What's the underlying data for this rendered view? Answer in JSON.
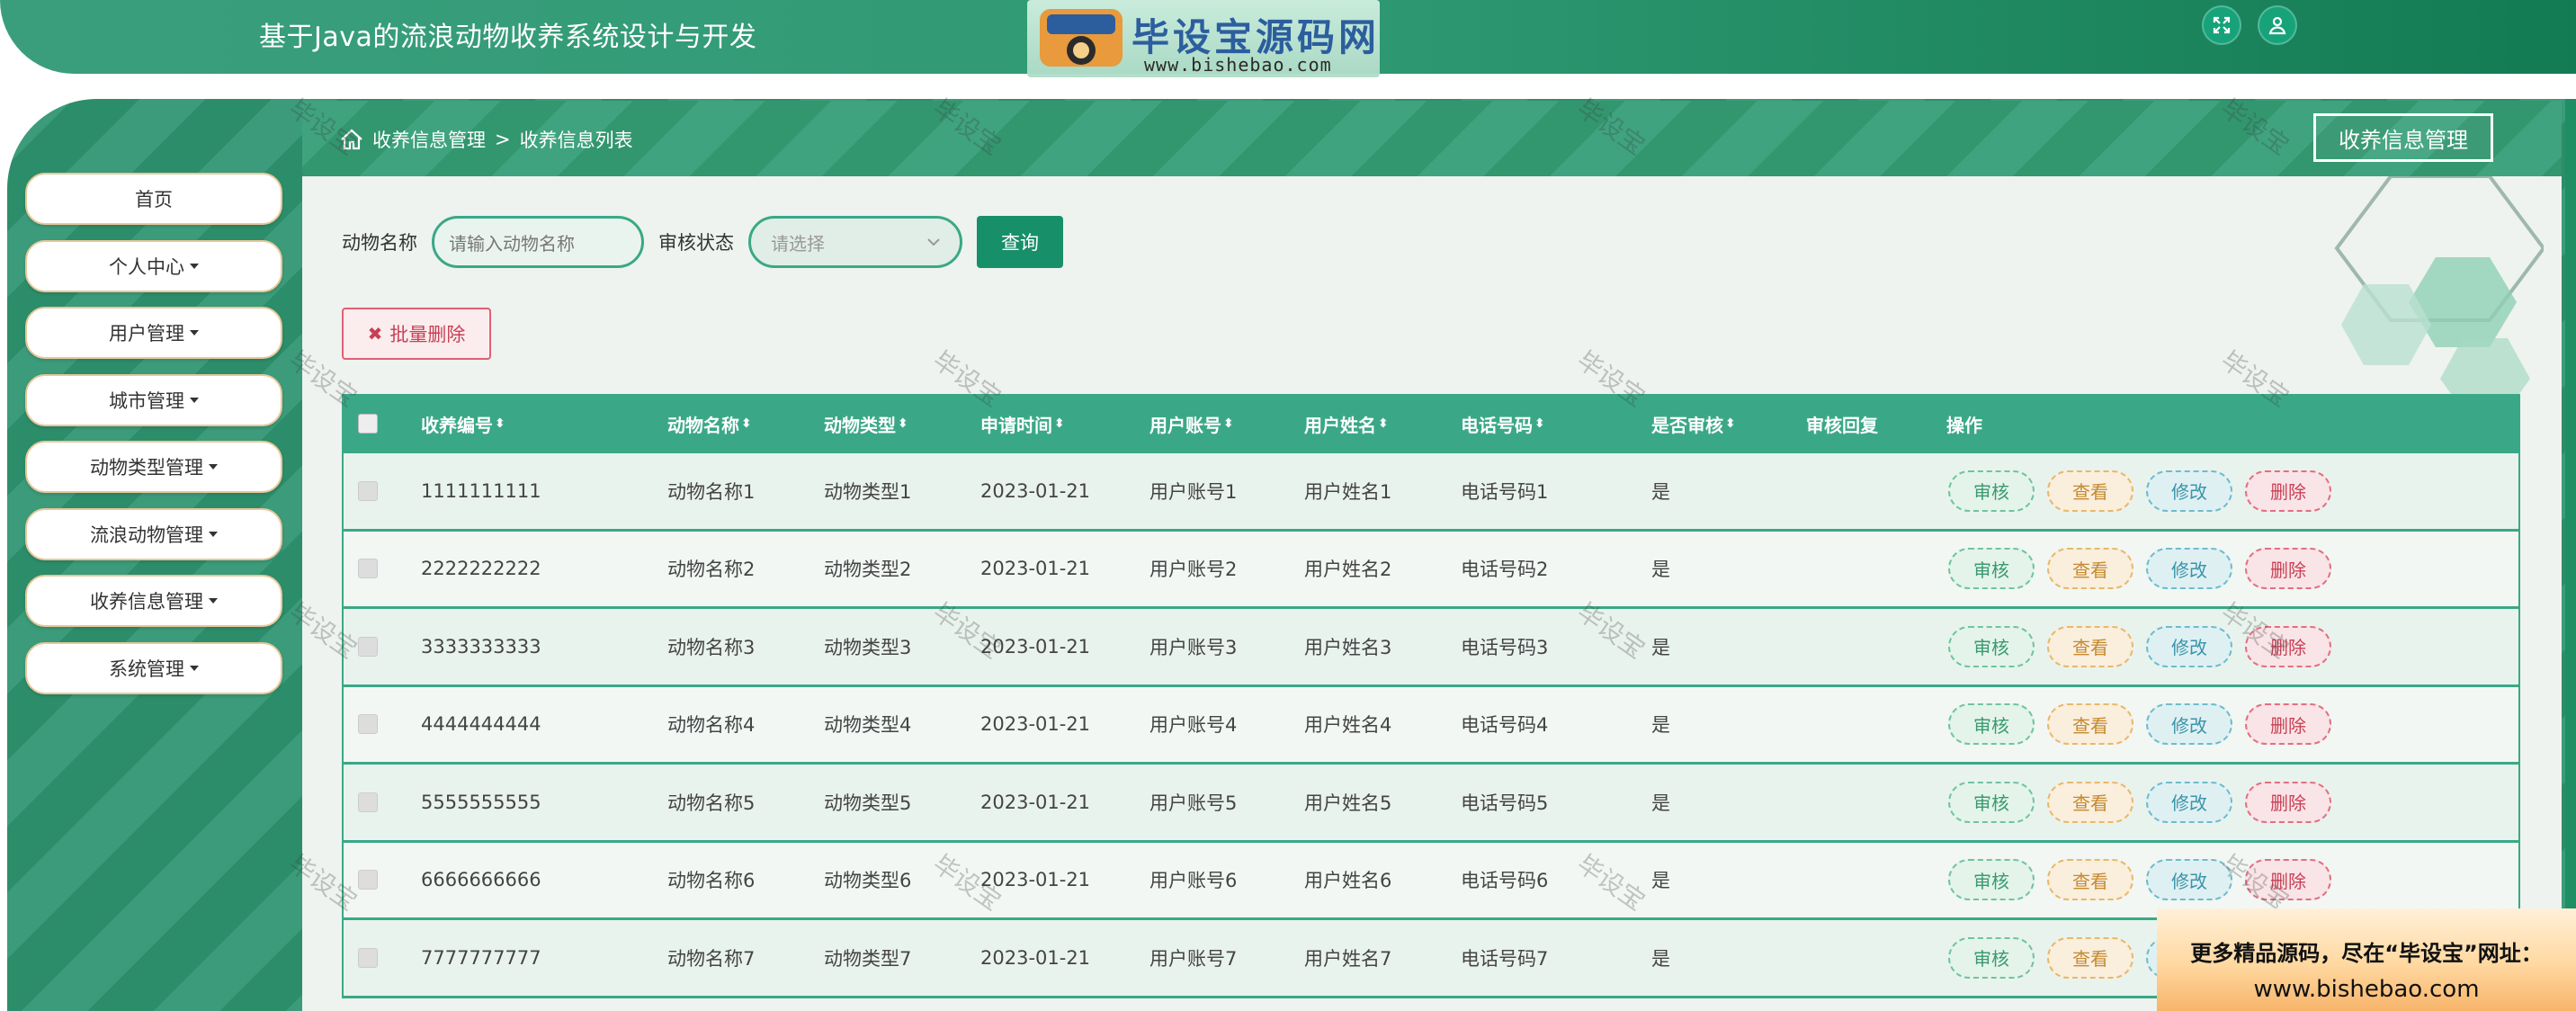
{
  "header": {
    "title": "基于Java的流浪动物收养系统设计与开发",
    "logo_text": "毕设宝源码网",
    "logo_badge": "毕设宝",
    "logo_url": "www.bishebao.com"
  },
  "breadcrumb": {
    "items": [
      "收养信息管理",
      "收养信息列表"
    ],
    "separator": ">"
  },
  "section_button": "收养信息管理",
  "sidebar": {
    "items": [
      {
        "label": "首页",
        "has_caret": false
      },
      {
        "label": "个人中心",
        "has_caret": true
      },
      {
        "label": "用户管理",
        "has_caret": true
      },
      {
        "label": "城市管理",
        "has_caret": true
      },
      {
        "label": "动物类型管理",
        "has_caret": true
      },
      {
        "label": "流浪动物管理",
        "has_caret": true
      },
      {
        "label": "收养信息管理",
        "has_caret": true
      },
      {
        "label": "系统管理",
        "has_caret": true
      }
    ]
  },
  "search": {
    "animal_name_label": "动物名称",
    "animal_name_placeholder": "请输入动物名称",
    "audit_status_label": "审核状态",
    "audit_status_value": "请选择",
    "query_label": "查询"
  },
  "bulk_delete_label": "批量删除",
  "table": {
    "columns": [
      "收养编号",
      "动物名称",
      "动物类型",
      "申请时间",
      "用户账号",
      "用户姓名",
      "电话号码",
      "是否审核",
      "审核回复",
      "操作"
    ],
    "actions": [
      "审核",
      "查看",
      "修改",
      "删除"
    ],
    "rows": [
      [
        "1111111111",
        "动物名称1",
        "动物类型1",
        "2023-01-21",
        "用户账号1",
        "用户姓名1",
        "电话号码1",
        "是",
        ""
      ],
      [
        "2222222222",
        "动物名称2",
        "动物类型2",
        "2023-01-21",
        "用户账号2",
        "用户姓名2",
        "电话号码2",
        "是",
        ""
      ],
      [
        "3333333333",
        "动物名称3",
        "动物类型3",
        "2023-01-21",
        "用户账号3",
        "用户姓名3",
        "电话号码3",
        "是",
        ""
      ],
      [
        "4444444444",
        "动物名称4",
        "动物类型4",
        "2023-01-21",
        "用户账号4",
        "用户姓名4",
        "电话号码4",
        "是",
        ""
      ],
      [
        "5555555555",
        "动物名称5",
        "动物类型5",
        "2023-01-21",
        "用户账号5",
        "用户姓名5",
        "电话号码5",
        "是",
        ""
      ],
      [
        "6666666666",
        "动物名称6",
        "动物类型6",
        "2023-01-21",
        "用户账号6",
        "用户姓名6",
        "电话号码6",
        "是",
        ""
      ],
      [
        "7777777777",
        "动物名称7",
        "动物类型7",
        "2023-01-21",
        "用户账号7",
        "用户姓名7",
        "电话号码7",
        "是",
        ""
      ]
    ]
  },
  "watermark_text": "毕设宝",
  "ad": {
    "line1": "更多精品源码，尽在“毕设宝”网址：",
    "line2": "www.bishebao.com"
  },
  "colors": {
    "primary": "#3aa887",
    "header_dark": "#137b53",
    "danger": "#c84055"
  }
}
